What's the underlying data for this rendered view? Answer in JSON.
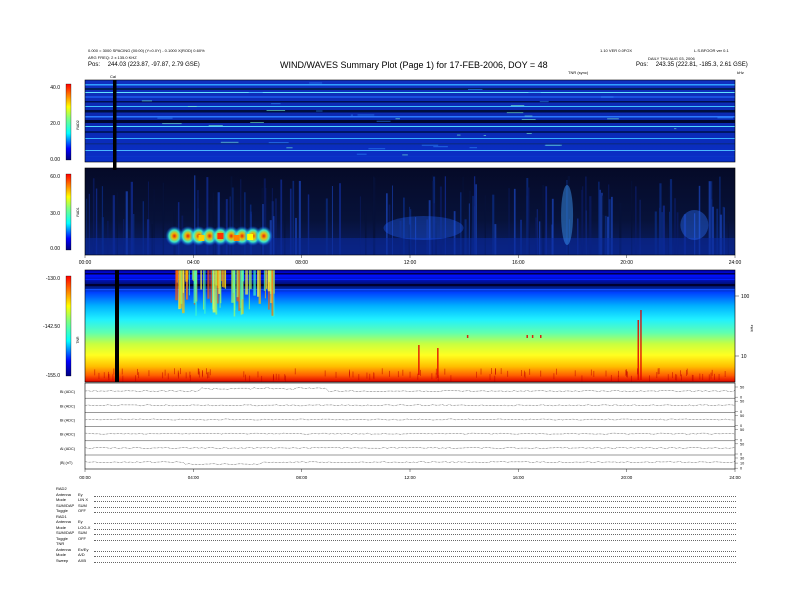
{
  "header": {
    "left_line1": "0.000 = 3000 SPACING (00:00) (Y=0.0Y) - 0.1000 X(ROD) 0.60%",
    "left_line2": "ARG FREQ: 2 x 135.0 KHZ",
    "left_pos_label": "Pos:",
    "left_pos_value": "244.03 (223.87, -97.87, 2.79 GSE)",
    "title": "WIND/WAVES Summary Plot (Page 1) for 17-FEB-2006, DOY = 48",
    "right_line1": "1.10 VER 0.0FOX",
    "right_line1b": "L.S.BFOOR ver 0.1",
    "right_line2": "DAILY  THU AUG 03, 2006",
    "right_pos_label": "Pos:",
    "right_pos_value": "243.35 (222.81, -185.3, 2.61 GSE)",
    "tnr_sync_label": "TNR (sync)",
    "khz_label": "kHz",
    "cal_label": "Cal"
  },
  "footer": {
    "rad2": {
      "name": "RAD2",
      "rows": [
        [
          "Antenna",
          "Ey"
        ],
        [
          "Mode",
          "LIN X"
        ],
        [
          "SUM/DAP",
          "SUM"
        ],
        [
          "Toggle",
          "OFF"
        ]
      ]
    },
    "rad1": {
      "name": "RAD1",
      "rows": [
        [
          "Antenna",
          "Ey"
        ],
        [
          "Mode",
          "LOG-X"
        ],
        [
          "SUM/DAP",
          "SUM"
        ],
        [
          "Toggle",
          "OFF"
        ]
      ]
    },
    "tnr": {
      "name": "TNR",
      "rows": [
        [
          "Antenna",
          "Ex/Ey"
        ],
        [
          "Mode",
          "A/D"
        ],
        [
          "Sweep",
          "AXB"
        ]
      ]
    }
  },
  "chart_data": [
    {
      "type": "heatmap",
      "panel": "RAD2",
      "ylabel": "RAD2",
      "yticks": [
        "40.0",
        "20.0",
        "0.00"
      ],
      "colorbar_ticks": [
        "40.0",
        "20.0",
        "0.00"
      ],
      "ylim": [
        0,
        40
      ],
      "x_range_hours": [
        0,
        24
      ],
      "colormap": "jet"
    },
    {
      "type": "heatmap",
      "panel": "RAD1",
      "ylabel": "RAD1",
      "yticks": [
        "60.0",
        "30.0",
        "0.00"
      ],
      "colorbar_ticks": [
        "60.0",
        "30.0",
        "0.00"
      ],
      "ylim": [
        0,
        60
      ],
      "xticks": [
        "00:00",
        "04:00",
        "08:00",
        "12:00",
        "16:00",
        "20:00",
        "24:00"
      ],
      "x_range_hours": [
        0,
        24
      ],
      "colormap": "jet",
      "feature": "Type III burst activity approximately 03:30 to 07:00 UT"
    },
    {
      "type": "heatmap",
      "panel": "TNR",
      "ylabel": "TNR",
      "yticks": [
        "-130.0",
        "-142.50",
        "-155.0"
      ],
      "colorbar_ticks": [
        "-130.0",
        "-142.50",
        "-155.0"
      ],
      "ylim": [
        -155,
        -130
      ],
      "right_ticks": [
        "100",
        "10"
      ],
      "right_unit": "kHz",
      "x_range_hours": [
        0,
        24
      ],
      "colormap": "jet"
    },
    {
      "type": "line",
      "panel": "magnetometer",
      "xticks": [
        "00:00",
        "04:00",
        "08:00",
        "12:00",
        "16:00",
        "20:00",
        "24:00"
      ],
      "x_range_hours": [
        0,
        24
      ],
      "series": [
        {
          "name": "Bl (ADC)",
          "right_ticks": [
            "50",
            "0"
          ]
        },
        {
          "name": "Bl (ADC)",
          "right_ticks": [
            "50",
            "0"
          ]
        },
        {
          "name": "Bl (ADC)",
          "right_ticks": [
            "50",
            "0"
          ]
        },
        {
          "name": "Bl (ADC)",
          "right_ticks": [
            "50",
            "0"
          ]
        },
        {
          "name": "Al (ADC)",
          "right_ticks": [
            "50",
            "0"
          ]
        },
        {
          "name": "|B| (nT)",
          "right_ticks": [
            "30",
            "10",
            "0"
          ]
        }
      ]
    }
  ],
  "colors": {
    "background": "#ffffff",
    "rad2_base": "#0a2aa6",
    "rad1_base": "#060f2e",
    "tnr_gradient": [
      "#0000b0",
      "#00c8ff",
      "#40ffc0",
      "#ffff40",
      "#ff8000",
      "#d00000"
    ]
  }
}
